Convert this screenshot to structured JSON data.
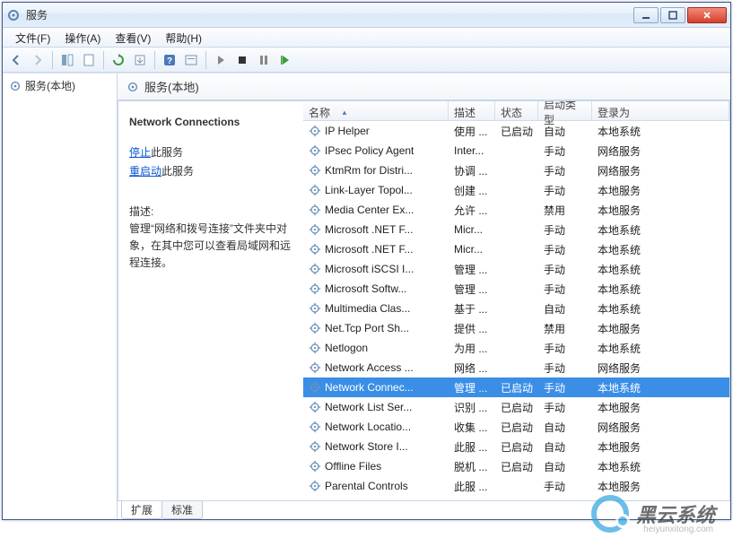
{
  "window": {
    "title": "服务"
  },
  "menu": {
    "file": "文件(F)",
    "action": "操作(A)",
    "view": "查看(V)",
    "help": "帮助(H)"
  },
  "left": {
    "root": "服务(本地)"
  },
  "right_header": "服务(本地)",
  "detail": {
    "name": "Network Connections",
    "stop_link": "停止",
    "stop_suffix": "此服务",
    "restart_link": "重启动",
    "restart_suffix": "此服务",
    "desc_label": "描述:",
    "desc_text": "管理“网络和拨号连接”文件夹中对象，在其中您可以查看局域网和远程连接。"
  },
  "columns": {
    "name": "名称",
    "desc": "描述",
    "status": "状态",
    "startup": "启动类型",
    "logon": "登录为"
  },
  "tabs": {
    "extended": "扩展",
    "standard": "标准"
  },
  "services": [
    {
      "name": "IP Helper",
      "desc": "使用 ...",
      "status": "已启动",
      "startup": "自动",
      "logon": "本地系统"
    },
    {
      "name": "IPsec Policy Agent",
      "desc": "Inter...",
      "status": "",
      "startup": "手动",
      "logon": "网络服务"
    },
    {
      "name": "KtmRm for Distri...",
      "desc": "协调 ...",
      "status": "",
      "startup": "手动",
      "logon": "网络服务"
    },
    {
      "name": "Link-Layer Topol...",
      "desc": "创建 ...",
      "status": "",
      "startup": "手动",
      "logon": "本地服务"
    },
    {
      "name": "Media Center Ex...",
      "desc": "允许 ...",
      "status": "",
      "startup": "禁用",
      "logon": "本地服务"
    },
    {
      "name": "Microsoft .NET F...",
      "desc": "Micr...",
      "status": "",
      "startup": "手动",
      "logon": "本地系统"
    },
    {
      "name": "Microsoft .NET F...",
      "desc": "Micr...",
      "status": "",
      "startup": "手动",
      "logon": "本地系统"
    },
    {
      "name": "Microsoft iSCSI I...",
      "desc": "管理 ...",
      "status": "",
      "startup": "手动",
      "logon": "本地系统"
    },
    {
      "name": "Microsoft Softw...",
      "desc": "管理 ...",
      "status": "",
      "startup": "手动",
      "logon": "本地系统"
    },
    {
      "name": "Multimedia Clas...",
      "desc": "基于 ...",
      "status": "",
      "startup": "自动",
      "logon": "本地系统"
    },
    {
      "name": "Net.Tcp Port Sh...",
      "desc": "提供 ...",
      "status": "",
      "startup": "禁用",
      "logon": "本地服务"
    },
    {
      "name": "Netlogon",
      "desc": "为用 ...",
      "status": "",
      "startup": "手动",
      "logon": "本地系统"
    },
    {
      "name": "Network Access ...",
      "desc": "网络 ...",
      "status": "",
      "startup": "手动",
      "logon": "网络服务"
    },
    {
      "name": "Network Connec...",
      "desc": "管理 ...",
      "status": "已启动",
      "startup": "手动",
      "logon": "本地系统",
      "selected": true
    },
    {
      "name": "Network List Ser...",
      "desc": "识别 ...",
      "status": "已启动",
      "startup": "手动",
      "logon": "本地服务"
    },
    {
      "name": "Network Locatio...",
      "desc": "收集 ...",
      "status": "已启动",
      "startup": "自动",
      "logon": "网络服务"
    },
    {
      "name": "Network Store I...",
      "desc": "此服 ...",
      "status": "已启动",
      "startup": "自动",
      "logon": "本地服务"
    },
    {
      "name": "Offline Files",
      "desc": "脱机 ...",
      "status": "已启动",
      "startup": "自动",
      "logon": "本地系统"
    },
    {
      "name": "Parental Controls",
      "desc": "此服 ...",
      "status": "",
      "startup": "手动",
      "logon": "本地服务"
    }
  ],
  "watermark": {
    "brand": "黑云系统",
    "url": "heiyunxitong.com"
  }
}
